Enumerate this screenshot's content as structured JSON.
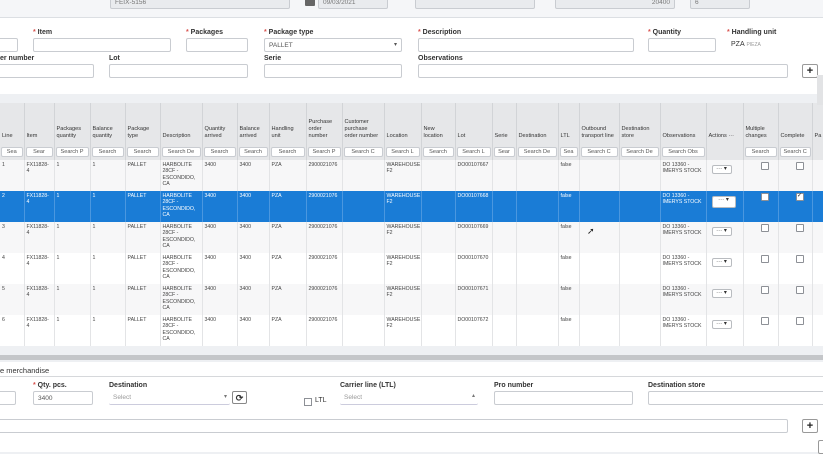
{
  "top": {
    "feix": "FEIX-5156",
    "date": "09/03/2021",
    "num1": "20400",
    "num2": "6"
  },
  "form": {
    "item_label": "Item",
    "packages_label": "Packages",
    "package_type_label": "Package type",
    "package_type_value": "PALLET",
    "description_label": "Description",
    "quantity_label": "Quantity",
    "handling_unit_label": "Handling unit",
    "handling_unit_value": "PZA",
    "handling_unit_sub": "PIEZA",
    "number_label": "er number",
    "lot_label": "Lot",
    "serie_label": "Serie",
    "observations_label": "Observations",
    "add_symbol": "+"
  },
  "table": {
    "headers": [
      "Line",
      "Item",
      "Packages quantity",
      "Balance quantity",
      "Package type",
      "Description",
      "Quantity arrived",
      "Balance arrived",
      "Handling unit",
      "Purchase order number",
      "Customer purchase order number",
      "Location",
      "New location",
      "Lot",
      "Serie",
      "Destination",
      "LTL",
      "Outbound transport line",
      "Destination store",
      "Observations",
      "Actions ···",
      "Multiple changes",
      "Complete",
      "Pa"
    ],
    "search": [
      "Sea",
      "Sear",
      "Search P",
      "Search",
      "Search",
      "Search De",
      "Search",
      "Search",
      "Search",
      "Search P",
      "Search C",
      "Search L",
      "Search",
      "Search L",
      "Sear",
      "Search De",
      "Sea",
      "Search C",
      "Search De",
      "Search Obs",
      "",
      "Search",
      "Search C",
      ""
    ],
    "rows": [
      {
        "line": "1",
        "item": "FX11828-4",
        "pk": "1",
        "bal": "1",
        "ptype": "PALLET",
        "desc": "HARBOLITE 28CF - ESCONDIDO, CA",
        "qa": "3400",
        "ba": "3400",
        "hu": "PZA",
        "po": "2900021076",
        "loc": "WAREHOUSE F2",
        "lot": "DO00107667",
        "ltl": "false",
        "obs": "DO 13360 - IMERYS STOCK",
        "complete": false,
        "multiple": false,
        "sel": false
      },
      {
        "line": "2",
        "item": "FX11828-4",
        "pk": "1",
        "bal": "1",
        "ptype": "PALLET",
        "desc": "HARBOLITE 28CF - ESCONDIDO, CA",
        "qa": "3400",
        "ba": "3400",
        "hu": "PZA",
        "po": "2900021076",
        "loc": "WAREHOUSE F2",
        "lot": "DO00107668",
        "ltl": "false",
        "obs": "DO 13360 - IMERYS STOCK",
        "complete": true,
        "multiple": false,
        "sel": true
      },
      {
        "line": "3",
        "item": "FX11828-4",
        "pk": "1",
        "bal": "1",
        "ptype": "PALLET",
        "desc": "HARBOLITE 28CF - ESCONDIDO, CA",
        "qa": "3400",
        "ba": "3400",
        "hu": "PZA",
        "po": "2900021076",
        "loc": "WAREHOUSE F2",
        "lot": "DO00107669",
        "ltl": "false",
        "obs": "DO 13360 - IMERYS STOCK",
        "complete": false,
        "multiple": false,
        "sel": false
      },
      {
        "line": "4",
        "item": "FX11828-4",
        "pk": "1",
        "bal": "1",
        "ptype": "PALLET",
        "desc": "HARBOLITE 28CF - ESCONDIDO, CA",
        "qa": "3400",
        "ba": "3400",
        "hu": "PZA",
        "po": "2900021076",
        "loc": "WAREHOUSE F2",
        "lot": "DO00107670",
        "ltl": "false",
        "obs": "DO 13360 - IMERYS STOCK",
        "complete": false,
        "multiple": false,
        "sel": false
      },
      {
        "line": "5",
        "item": "FX11828-4",
        "pk": "1",
        "bal": "1",
        "ptype": "PALLET",
        "desc": "HARBOLITE 28CF - ESCONDIDO, CA",
        "qa": "3400",
        "ba": "3400",
        "hu": "PZA",
        "po": "2900021076",
        "loc": "WAREHOUSE F2",
        "lot": "DO00107671",
        "ltl": "false",
        "obs": "DO 13360 - IMERYS STOCK",
        "complete": false,
        "multiple": false,
        "sel": false
      },
      {
        "line": "6",
        "item": "FX11828-4",
        "pk": "1",
        "bal": "1",
        "ptype": "PALLET",
        "desc": "HARBOLITE 28CF - ESCONDIDO, CA",
        "qa": "3400",
        "ba": "3400",
        "hu": "PZA",
        "po": "2900021076",
        "loc": "WAREHOUSE F2",
        "lot": "DO00107672",
        "ltl": "false",
        "obs": "DO 13360 - IMERYS STOCK",
        "complete": false,
        "multiple": false,
        "sel": false
      }
    ],
    "actions_symbol": "··· ▾"
  },
  "bottom": {
    "section_title": "e merchandise",
    "qty_label": "Qty. pcs.",
    "qty_value": "3400",
    "destination_label": "Destination",
    "destination_placeholder": "Select",
    "ltl_label": "LTL",
    "carrier_label": "Carrier line (LTL)",
    "carrier_placeholder": "Select",
    "pro_label": "Pro number",
    "store_label": "Destination store",
    "refresh_symbol": "⟳",
    "add_symbol": "+"
  }
}
